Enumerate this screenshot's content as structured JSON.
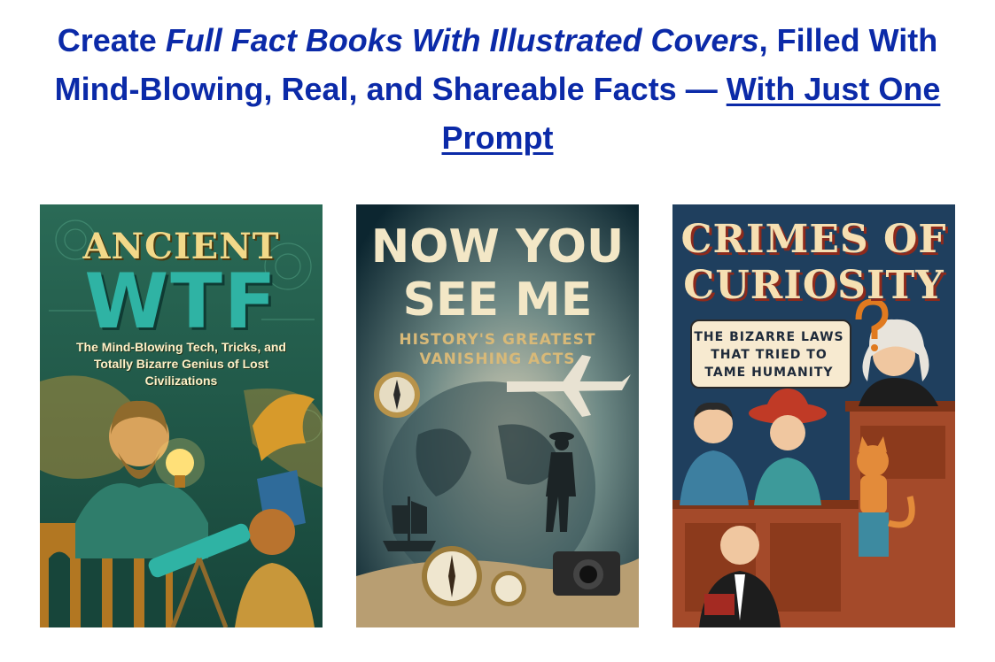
{
  "headline": {
    "part1": "Create ",
    "emphasis": "Full Fact Books With Illustrated Covers",
    "part2": ", Filled With Mind-Blowing, Real, and Shareable Facts — ",
    "link": "With Just One Prompt"
  },
  "covers": [
    {
      "title_top": "ANCIENT",
      "title_main": "WTF",
      "subtitle": "The Mind-Blowing Tech, Tricks, and Totally Bizarre Genius of Lost Civilizations",
      "colors": {
        "bg": "#1f5a4a",
        "accent": "#2fb3a4",
        "gold": "#d79a2b"
      }
    },
    {
      "title": "NOW YOU SEE ME",
      "subtitle": "HISTORY'S GREATEST VANISHING ACTS",
      "colors": {
        "bg": "#0f2f3a",
        "fog": "#9fb3ad",
        "accent": "#d8b978"
      }
    },
    {
      "title": "CRIMES OF CURIOSITY",
      "subtitle": "THE BIZARRE LAWS THAT TRIED TO TAME HUMANITY",
      "colors": {
        "bg": "#1f3f5e",
        "wood": "#a44a2a",
        "accent": "#f6e0b2"
      }
    }
  ]
}
